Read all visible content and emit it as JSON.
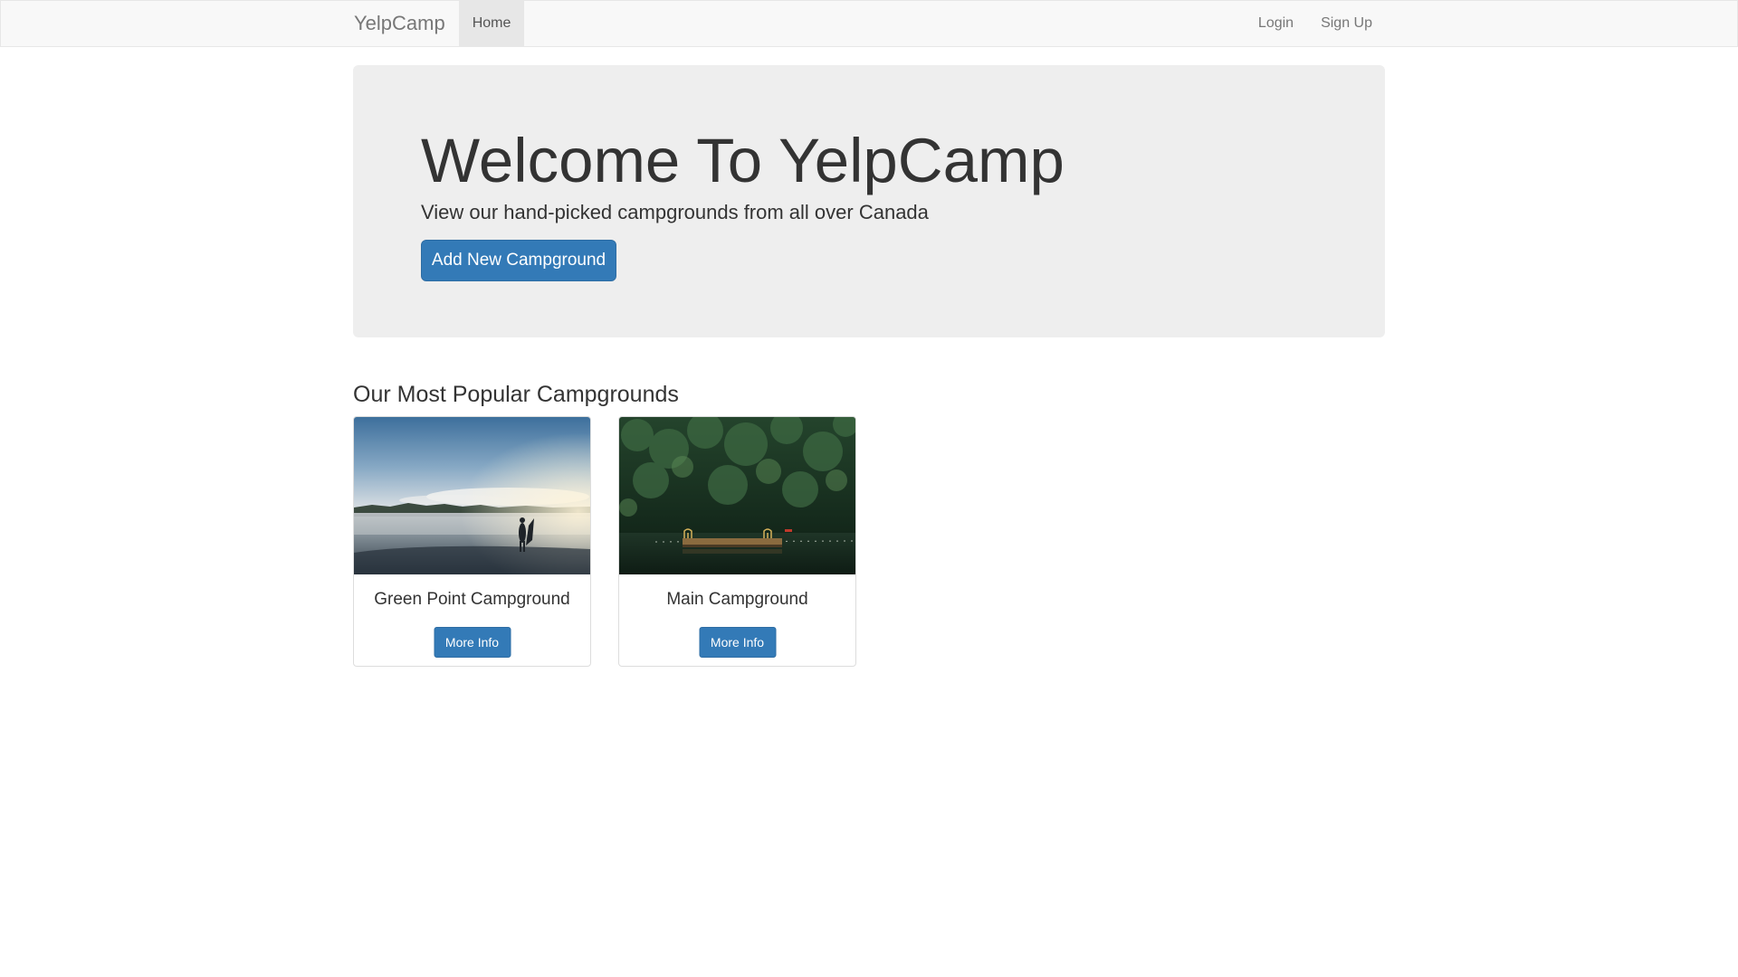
{
  "navbar": {
    "brand": "YelpCamp",
    "left_links": [
      {
        "label": "Home",
        "active": true
      }
    ],
    "right_links": [
      {
        "label": "Login"
      },
      {
        "label": "Sign Up"
      }
    ]
  },
  "jumbotron": {
    "title": "Welcome To YelpCamp",
    "subtitle": "View our hand-picked campgrounds from all over Canada",
    "button_label": "Add New Campground"
  },
  "popular": {
    "heading": "Our Most Popular Campgrounds",
    "cards": [
      {
        "name": "Green Point Campground",
        "button_label": "More Info"
      },
      {
        "name": "Main Campground",
        "button_label": "More Info"
      }
    ]
  },
  "colors": {
    "primary": "#337ab7",
    "navbar_bg": "#f8f8f8",
    "jumbotron_bg": "#eeeeee",
    "text": "#333333",
    "nav_text": "#777777"
  }
}
